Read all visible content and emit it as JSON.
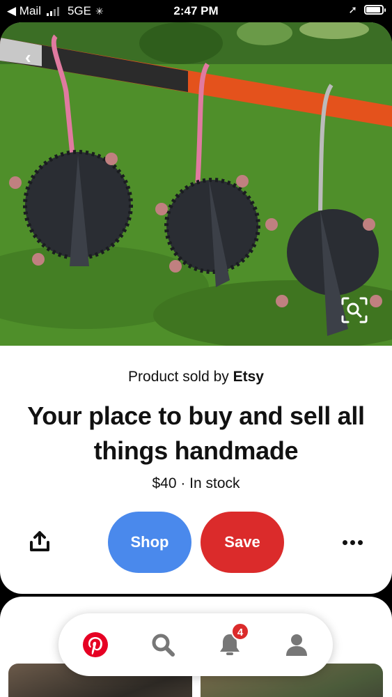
{
  "status_bar": {
    "back_app": "Mail",
    "network": "5GE",
    "time": "2:47 PM"
  },
  "product": {
    "sold_by_prefix": "Product sold by",
    "seller": "Etsy",
    "title": "Your place to buy and sell all things handmade",
    "price_line": "$40 · In stock",
    "shop_label": "Shop",
    "save_label": "Save"
  },
  "nav": {
    "notification_count": "4"
  },
  "colors": {
    "shop_button": "#4a89ec",
    "save_button": "#db2b2b",
    "pinterest_brand": "#e60023"
  },
  "icons": [
    "back-arrow-icon",
    "visual-search-icon",
    "share-icon",
    "more-icon",
    "pinterest-home-icon",
    "search-icon",
    "bell-icon",
    "profile-icon"
  ]
}
